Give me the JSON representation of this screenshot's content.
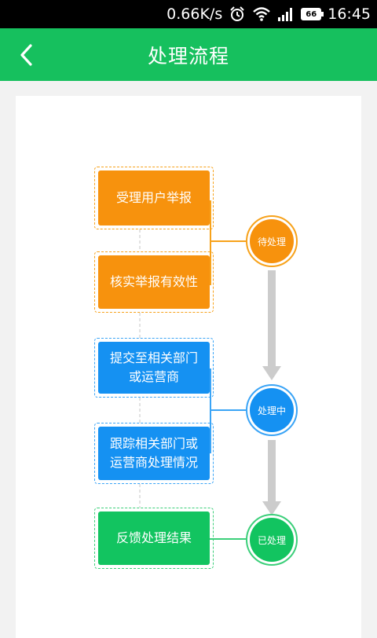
{
  "statusbar": {
    "speed": "0.66K/s",
    "battery": "66",
    "time": "16:45",
    "icons": [
      "alarm-icon",
      "wifi-icon",
      "signal-icon",
      "battery-icon"
    ]
  },
  "header": {
    "title": "处理流程",
    "back_icon": "chevron-left-icon",
    "color": "#16c05e"
  },
  "flow": {
    "steps": [
      {
        "label": "受理用户举报",
        "stage": "pending"
      },
      {
        "label": "核实举报有效性",
        "stage": "pending"
      },
      {
        "label": "提交至相关部门\n或运营商",
        "stage": "processing"
      },
      {
        "label": "跟踪相关部门或\n运营商处理情况",
        "stage": "processing"
      },
      {
        "label": "反馈处理结果",
        "stage": "done"
      }
    ],
    "stages": {
      "pending": {
        "label": "待处理",
        "color": "#f7920d"
      },
      "processing": {
        "label": "处理中",
        "color": "#1591f2"
      },
      "done": {
        "label": "已处理",
        "color": "#12c460"
      }
    }
  }
}
